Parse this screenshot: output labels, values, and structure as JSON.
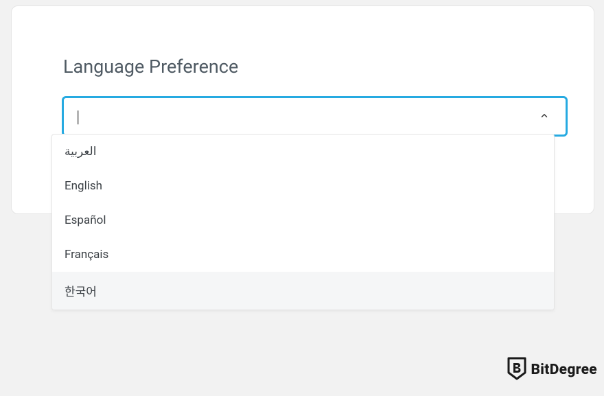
{
  "heading": "Language Preference",
  "combobox": {
    "value": "",
    "cursor": "|"
  },
  "options": [
    {
      "label": "العربية",
      "highlighted": false,
      "rtl": true
    },
    {
      "label": "English",
      "highlighted": false,
      "rtl": false
    },
    {
      "label": "Español",
      "highlighted": false,
      "rtl": false
    },
    {
      "label": "Français",
      "highlighted": false,
      "rtl": false
    },
    {
      "label": "한국어",
      "highlighted": true,
      "rtl": false
    }
  ],
  "brand": {
    "name": "BitDegree"
  }
}
